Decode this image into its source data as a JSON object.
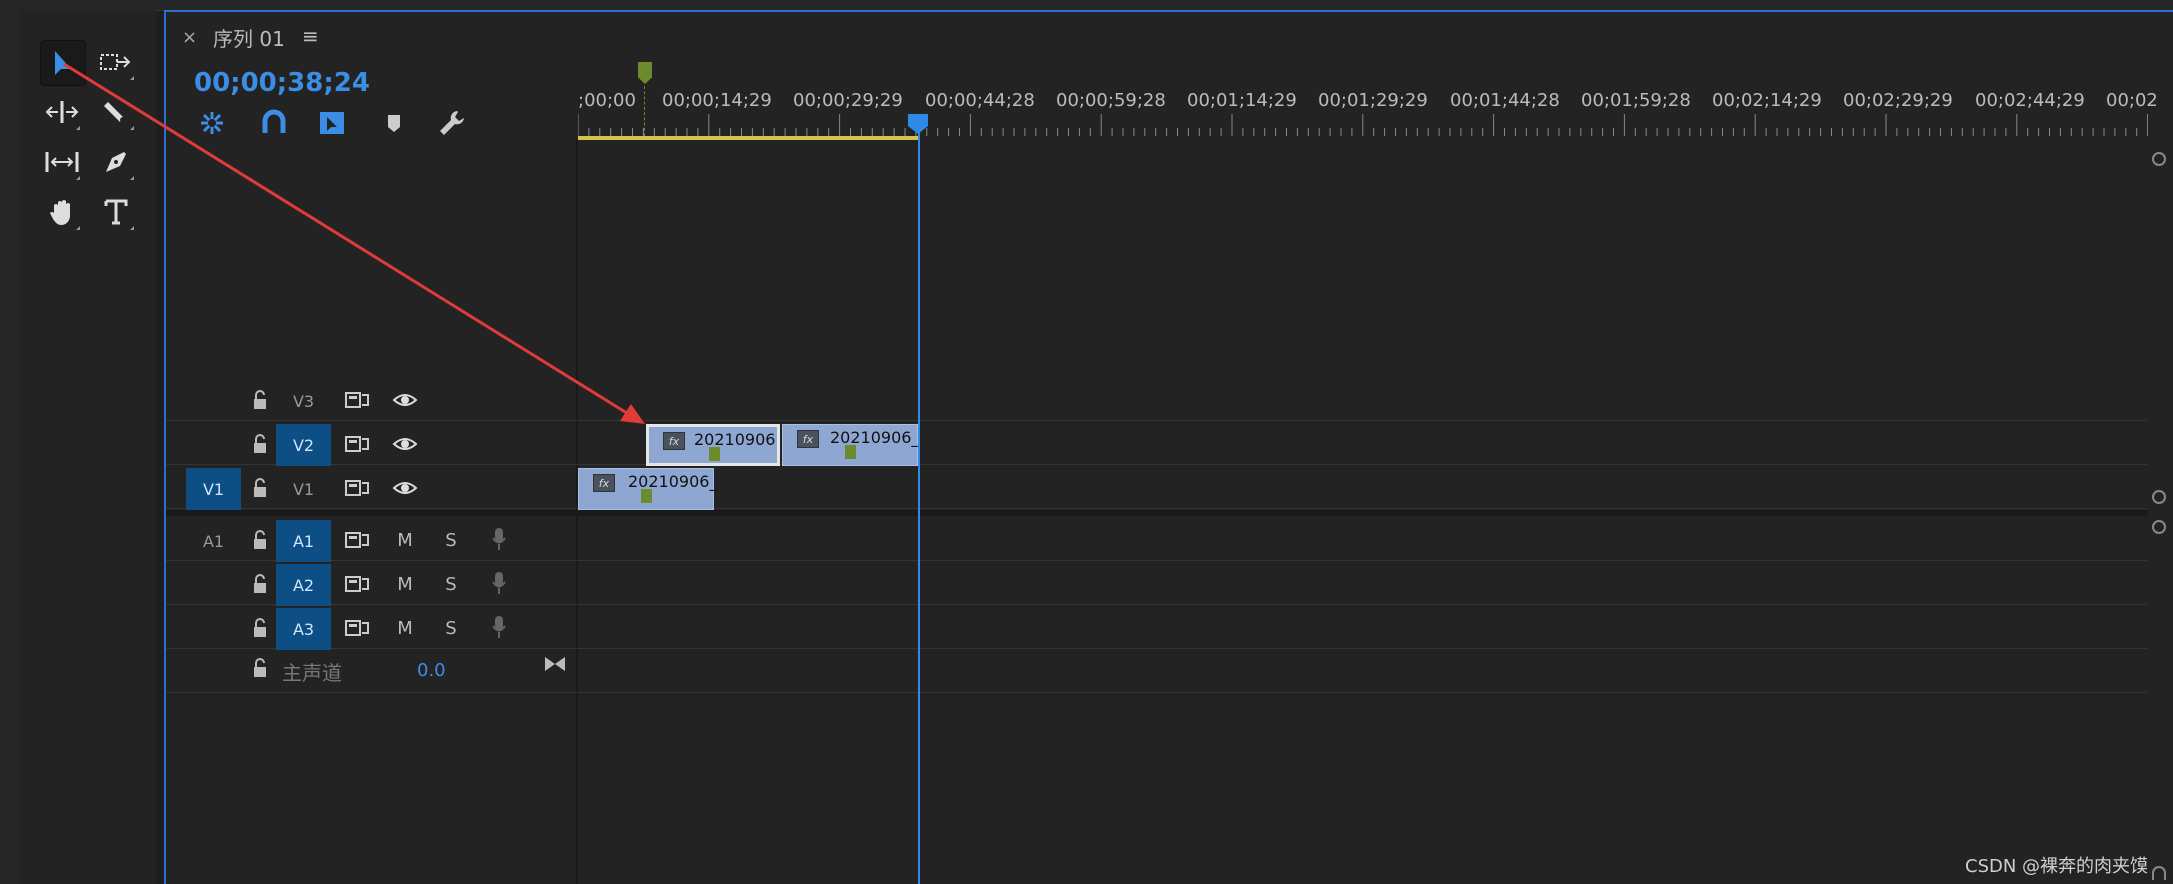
{
  "tab": {
    "close": "×",
    "title": "序列 01",
    "menu": "≡"
  },
  "timecode": "00;00;38;24",
  "ruler_labels": [
    ";00;00",
    "00;00;14;29",
    "00;00;29;29",
    "00;00;44;28",
    "00;00;59;28",
    "00;01;14;29",
    "00;01;29;29",
    "00;01;44;28",
    "00;01;59;28",
    "00;02;14;29",
    "00;02;29;29",
    "00;02;44;29",
    "00;02"
  ],
  "tracks": {
    "V3": {
      "label": "V3"
    },
    "V2": {
      "label": "V2"
    },
    "V1": {
      "label": "V1",
      "source": "V1"
    },
    "A1": {
      "label": "A1",
      "source": "A1",
      "m": "M",
      "s": "S"
    },
    "A2": {
      "label": "A2",
      "m": "M",
      "s": "S"
    },
    "A3": {
      "label": "A3",
      "m": "M",
      "s": "S"
    },
    "master": {
      "label": "主声道",
      "value": "0.0"
    }
  },
  "clips": {
    "v2a": {
      "name": "20210906",
      "fx": "fx"
    },
    "v2b": {
      "name": "20210906_",
      "fx": "fx"
    },
    "v1a": {
      "name": "20210906_",
      "fx": "fx"
    }
  },
  "watermark": "CSDN @裸奔的肉夹馍",
  "colors": {
    "accent": "#2d8ae6",
    "clip": "#8da7d2",
    "track_on": "#0d4f85",
    "marker": "#6c8b2c",
    "arrow": "#e03a3a"
  }
}
